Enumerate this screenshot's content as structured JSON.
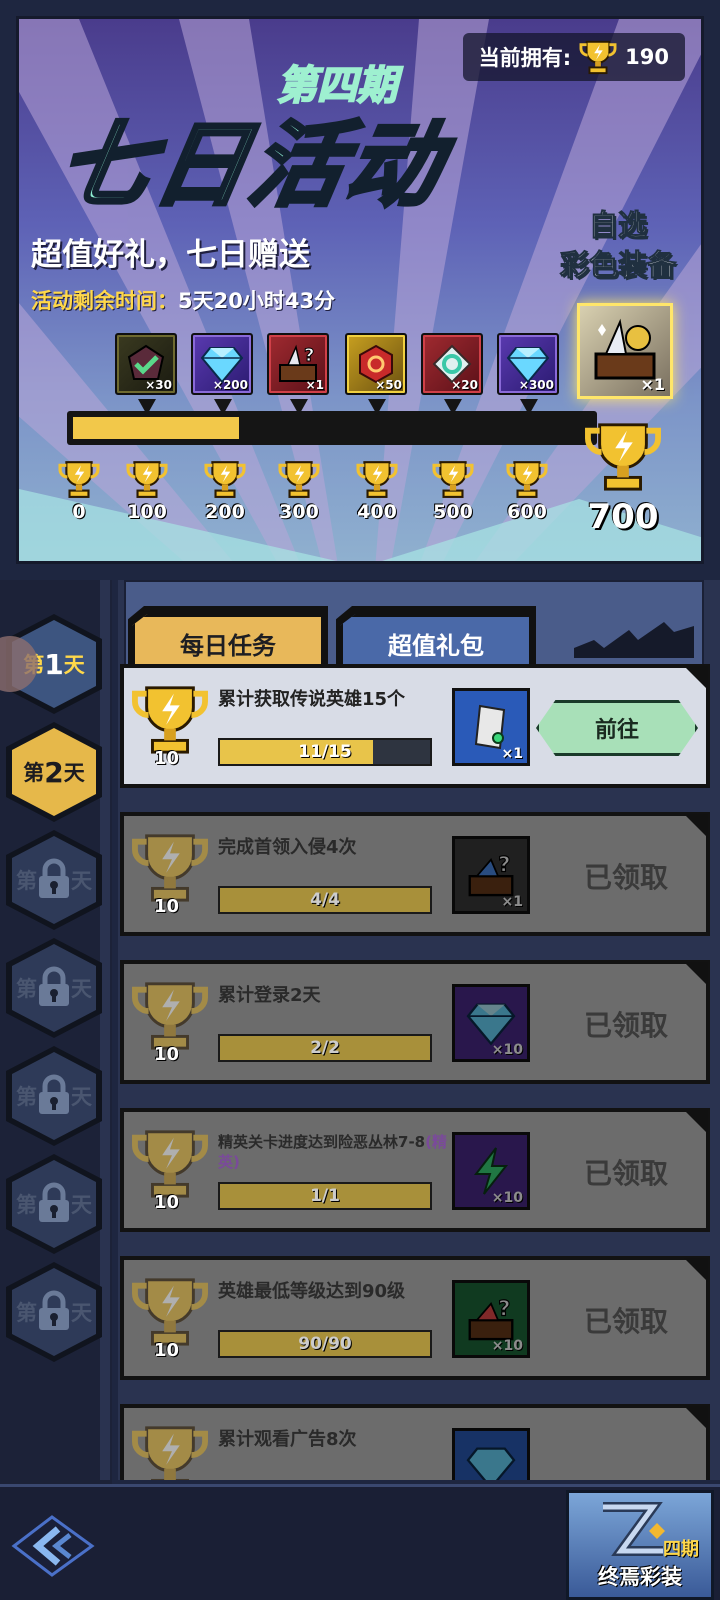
{
  "banner": {
    "owned_label": "当前拥有:",
    "owned_value": "190",
    "period": "第四期",
    "title": "七日活动",
    "subtitle": "超值好礼，七日赠送",
    "timer_label": "活动剩余时间：",
    "timer_value": "5天20小时43分",
    "pick_line1": "自选",
    "pick_line2": "彩色装备",
    "progress_value": 190,
    "progress_max": 700,
    "rewards": [
      {
        "qty": "×30",
        "icon": "check-gem-icon",
        "style": "dark"
      },
      {
        "qty": "×200",
        "icon": "diamond-icon",
        "style": "purple"
      },
      {
        "qty": "×1",
        "icon": "mystery-chest-icon",
        "style": "red"
      },
      {
        "qty": "×50",
        "icon": "red-gem-icon",
        "style": "gold"
      },
      {
        "qty": "×20",
        "icon": "rune-icon",
        "style": "red"
      },
      {
        "qty": "×300",
        "icon": "diamond-icon",
        "style": "purple"
      }
    ],
    "big_reward_qty": "×1",
    "milestones": [
      "0",
      "100",
      "200",
      "300",
      "400",
      "500",
      "600"
    ],
    "final_milestone": "700"
  },
  "sidebar": {
    "days": [
      {
        "label_pre": "第",
        "num": "1",
        "label_post": "天",
        "state": "unlocked"
      },
      {
        "label_pre": "第",
        "num": "2",
        "label_post": "天",
        "state": "selected"
      },
      {
        "label_pre": "第",
        "num": "",
        "label_post": "天",
        "state": "locked"
      },
      {
        "label_pre": "第",
        "num": "",
        "label_post": "天",
        "state": "locked"
      },
      {
        "label_pre": "第",
        "num": "",
        "label_post": "天",
        "state": "locked"
      },
      {
        "label_pre": "第",
        "num": "",
        "label_post": "天",
        "state": "locked"
      },
      {
        "label_pre": "第",
        "num": "",
        "label_post": "天",
        "state": "locked"
      }
    ]
  },
  "tabs": {
    "daily": "每日任务",
    "pack": "超值礼包"
  },
  "tasks": [
    {
      "title": "累计获取传说英雄15个",
      "tag": "",
      "progress": "11/15",
      "ratio": 0.73,
      "points": "10",
      "reward_qty": "×1",
      "reward_icon": "scroll-icon",
      "reward_bg": "#2a5ab8",
      "status": "go",
      "button": "前往"
    },
    {
      "title": "完成首领入侵4次",
      "tag": "",
      "progress": "4/4",
      "ratio": 1,
      "points": "10",
      "reward_qty": "×1",
      "reward_icon": "mystery-chest-icon",
      "reward_bg": "#3a3a3a",
      "status": "claimed",
      "button": "已领取"
    },
    {
      "title": "累计登录2天",
      "tag": "",
      "progress": "2/2",
      "ratio": 1,
      "points": "10",
      "reward_qty": "×10",
      "reward_icon": "diamond-icon",
      "reward_bg": "#4a2a8a",
      "status": "claimed",
      "button": "已领取"
    },
    {
      "title": "精英关卡进度达到险恶丛林7-8",
      "tag": "(精英)",
      "progress": "1/1",
      "ratio": 1,
      "points": "10",
      "reward_qty": "×10",
      "reward_icon": "energy-icon",
      "reward_bg": "#4a2a8a",
      "status": "claimed",
      "button": "已领取"
    },
    {
      "title": "英雄最低等级达到90级",
      "tag": "",
      "progress": "90/90",
      "ratio": 1,
      "points": "10",
      "reward_qty": "×10",
      "reward_icon": "mystery-chest-icon",
      "reward_bg": "#1e6a3a",
      "status": "claimed",
      "button": "已领取"
    },
    {
      "title": "累计观看广告8次",
      "tag": "",
      "progress": "",
      "ratio": 0,
      "points": "10",
      "reward_qty": "",
      "reward_icon": "diamond-icon",
      "reward_bg": "#2a5ab8",
      "status": "partial",
      "button": ""
    }
  ],
  "footer": {
    "final_line1": "四期",
    "final_line2": "终焉彩装"
  }
}
